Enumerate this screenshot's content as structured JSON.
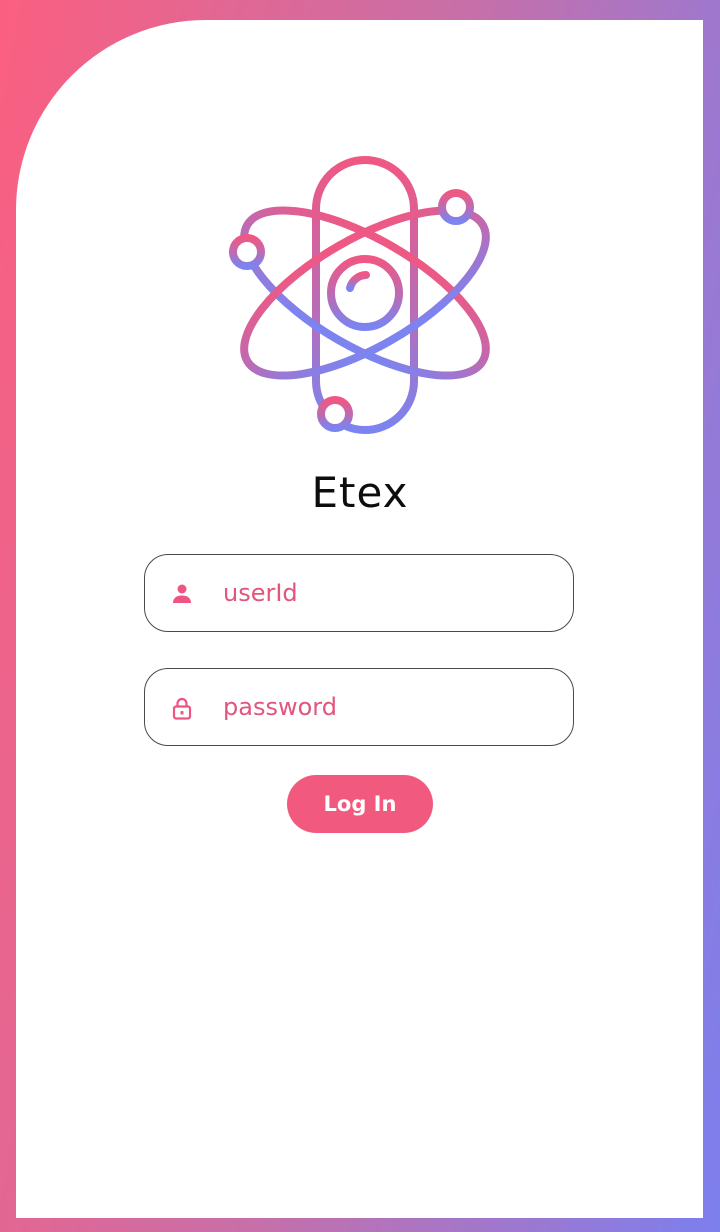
{
  "app": {
    "name": "Etex",
    "logo_icon": "atom-icon"
  },
  "form": {
    "user_placeholder": "userId",
    "user_value": "",
    "user_icon": "person-icon",
    "password_placeholder": "password",
    "password_value": "",
    "password_icon": "lock-icon",
    "login_label": "Log In"
  },
  "colors": {
    "gradient_start": "#fb5f80",
    "gradient_end": "#7c7fee",
    "accent": "#f15a7e",
    "placeholder_text": "#e2557c",
    "field_border": "#4a4a4a",
    "card_background": "#ffffff"
  }
}
